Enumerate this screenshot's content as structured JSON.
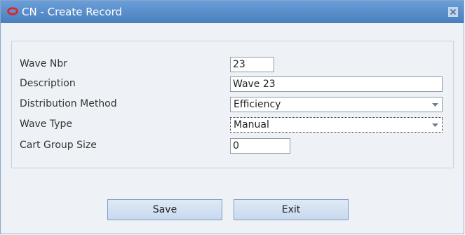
{
  "window": {
    "title": "CN - Create Record",
    "title_icon": "oracle-logo-icon",
    "close_icon": "close-icon",
    "accent_color": "#5a8fcc",
    "logo_color": "#e8201b"
  },
  "form": {
    "wave_nbr": {
      "label": "Wave Nbr",
      "value": "23"
    },
    "description": {
      "label": "Description",
      "value": "Wave 23"
    },
    "distribution_method": {
      "label": "Distribution Method",
      "value": "Efficiency"
    },
    "wave_type": {
      "label": "Wave Type",
      "value": "Manual"
    },
    "cart_group_size": {
      "label": "Cart Group Size",
      "value": "0"
    }
  },
  "buttons": {
    "save": "Save",
    "exit": "Exit"
  }
}
